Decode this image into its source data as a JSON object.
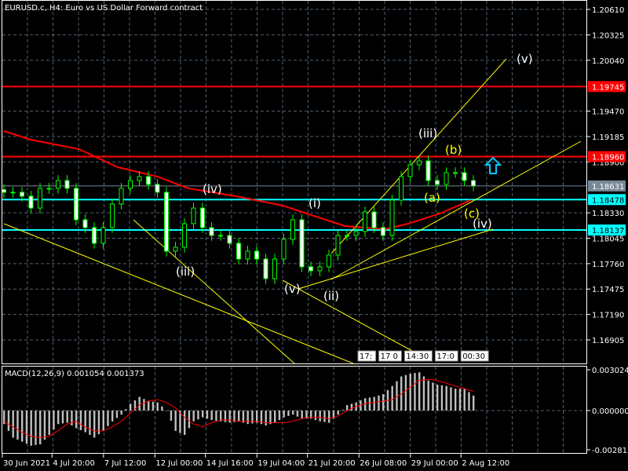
{
  "chart_data": {
    "type": "candlestick",
    "title": "EURUSD.c, H4:  Euro vs US Dollar Forward contract",
    "symbol": "EURUSD.c",
    "timeframe": "H4",
    "price_axis": {
      "ticks": [
        "1.20610",
        "1.20325",
        "1.20040",
        "1.19470",
        "1.19185",
        "1.18900",
        "1.18330",
        "1.18045",
        "1.17760",
        "1.17475",
        "1.17190",
        "1.16905"
      ],
      "ylim": [
        1.16037,
        1.2072
      ]
    },
    "time_axis": {
      "ticks": [
        {
          "label": "30 Jun 2021",
          "bar": 0
        },
        {
          "label": "4 Jul 20:00",
          "bar": 5.5
        },
        {
          "label": "7 Jul 12:00",
          "bar": 11.2
        },
        {
          "label": "12 Jul 00:00",
          "bar": 16.9
        },
        {
          "label": "14 Jul 16:00",
          "bar": 22.5
        },
        {
          "label": "19 Jul 04:00",
          "bar": 28.2
        },
        {
          "label": "21 Jul 20:00",
          "bar": 33.8
        },
        {
          "label": "26 Jul 08:00",
          "bar": 39.5
        },
        {
          "label": "29 Jul 00:00",
          "bar": 45.2
        },
        {
          "label": "2 Aug 12:00",
          "bar": 50.8
        }
      ]
    },
    "closes": [
      1.1856,
      1.1856,
      1.18516,
      1.18383,
      1.18604,
      1.18604,
      1.18692,
      1.18604,
      1.18252,
      1.18164,
      1.17988,
      1.18164,
      1.18428,
      1.18604,
      1.18692,
      1.18736,
      1.18648,
      1.1856,
      1.179,
      1.17944,
      1.18208,
      1.18383,
      1.18164,
      1.18076,
      1.18076,
      1.17988,
      1.17812,
      1.179,
      1.17812,
      1.17592,
      1.17812,
      1.18032,
      1.18252,
      1.17724,
      1.1768,
      1.17724,
      1.17856,
      1.18076,
      1.18076,
      1.1812,
      1.1834,
      1.18164,
      1.18076,
      1.18472,
      1.18736,
      1.18868,
      1.18912,
      1.18692,
      1.18648,
      1.1878,
      1.1878,
      1.18692,
      1.18631
    ],
    "moving_average": [
      [
        0,
        1.19246
      ],
      [
        3,
        1.19149
      ],
      [
        8.3,
        1.19044
      ],
      [
        12.6,
        1.18841
      ],
      [
        17,
        1.18736
      ],
      [
        20.4,
        1.18604
      ],
      [
        25.7,
        1.18516
      ],
      [
        30.9,
        1.1841
      ],
      [
        34.3,
        1.18296
      ],
      [
        37.8,
        1.18181
      ],
      [
        42.2,
        1.18146
      ],
      [
        44.8,
        1.18208
      ],
      [
        48.3,
        1.18322
      ],
      [
        51.7,
        1.18472
      ]
    ],
    "horizontal_levels": [
      {
        "price": 1.19745,
        "label": "1.19745",
        "color": "#ff0000",
        "kind": "resistance"
      },
      {
        "price": 1.1896,
        "label": "1.18960",
        "color": "#ff0000",
        "kind": "resistance"
      },
      {
        "price": 1.18478,
        "label": "1.18478",
        "color": "#00ffff",
        "kind": "support"
      },
      {
        "price": 1.18137,
        "label": "1.18137",
        "color": "#00ffff",
        "kind": "support"
      },
      {
        "price": 1.18631,
        "label": "1.18631",
        "color": "#778899",
        "kind": "bid"
      }
    ],
    "wave_labels": [
      {
        "text": "(iii)",
        "color": "#ffffff"
      },
      {
        "text": "(iv)",
        "color": "#ffffff"
      },
      {
        "text": "(v)",
        "color": "#ffffff"
      },
      {
        "text": "(i)",
        "color": "#ffffff"
      },
      {
        "text": "(ii)",
        "color": "#ffffff"
      },
      {
        "text": "(iii)",
        "color": "#ffffff"
      },
      {
        "text": "(v)",
        "color": "#ffffff"
      },
      {
        "text": "(b)",
        "color": "#ffff00"
      },
      {
        "text": "(a)",
        "color": "#ffff00"
      },
      {
        "text": "(c)",
        "color": "#ffff00"
      },
      {
        "text": "(iv)",
        "color": "#ffffff"
      }
    ],
    "time_markers": [
      "17:",
      "17 0",
      "14:30",
      "17:0",
      "00:30"
    ],
    "macd": {
      "label": "MACD(12,26,9) 0.001054 0.001373",
      "ticks": [
        "0.003024",
        "0.000000",
        "-0.002812"
      ],
      "ylim": [
        -0.002812,
        0.003024
      ],
      "histogram": [
        -0.001,
        -0.002,
        -0.0023,
        -0.0026,
        -0.0025,
        -0.0018,
        -0.001,
        -0.0009,
        -0.0013,
        -0.0016,
        -0.002,
        -0.0015,
        -0.0008,
        -0.0003,
        0.0005,
        0.001,
        0.0007,
        0.0006,
        0.0,
        -0.0015,
        -0.0018,
        -0.0008,
        -0.0005,
        -0.0007,
        -0.0008,
        -0.0009,
        -0.0008,
        -0.001,
        -0.0009,
        -0.0011,
        -0.0009,
        -0.0005,
        -0.0003,
        -0.0006,
        -0.0006,
        -0.0008,
        -0.0009,
        -0.0003,
        0.0004,
        0.0006,
        0.0009,
        0.001,
        0.0012,
        0.0018,
        0.0025,
        0.0027,
        0.0028,
        0.0022,
        0.0019,
        0.0018,
        0.0016,
        0.0016,
        0.0011
      ],
      "signal": [
        -0.0008,
        -0.0012,
        -0.0016,
        -0.0019,
        -0.002,
        -0.0019,
        -0.0015,
        -0.001,
        -0.0008,
        -0.0012,
        -0.0015,
        -0.0015,
        -0.0012,
        -0.0008,
        -0.0002,
        0.0004,
        0.0007,
        0.0008,
        0.0006,
        0.0002,
        -0.0005,
        -0.001,
        -0.0012,
        -0.0009,
        -0.0007,
        -0.0007,
        -0.0008,
        -0.0008,
        -0.0008,
        -0.0009,
        -0.0009,
        -0.0009,
        -0.0008,
        -0.0006,
        -0.0005,
        -0.0005,
        -0.0006,
        -0.0004,
        0.0,
        0.0003,
        0.0005,
        0.0006,
        0.0007,
        0.0008,
        0.0012,
        0.0017,
        0.0022,
        0.0023,
        0.0022,
        0.002,
        0.0018,
        0.0016,
        0.0014
      ]
    },
    "colors": {
      "bull": "#00ff00",
      "ma": "#ff0000",
      "trendline": "#ffff00",
      "grid": "#4f6070",
      "macd_hist": "#c0c0c0",
      "signal": "#ff0000",
      "arrow": "#00c8ff"
    }
  }
}
